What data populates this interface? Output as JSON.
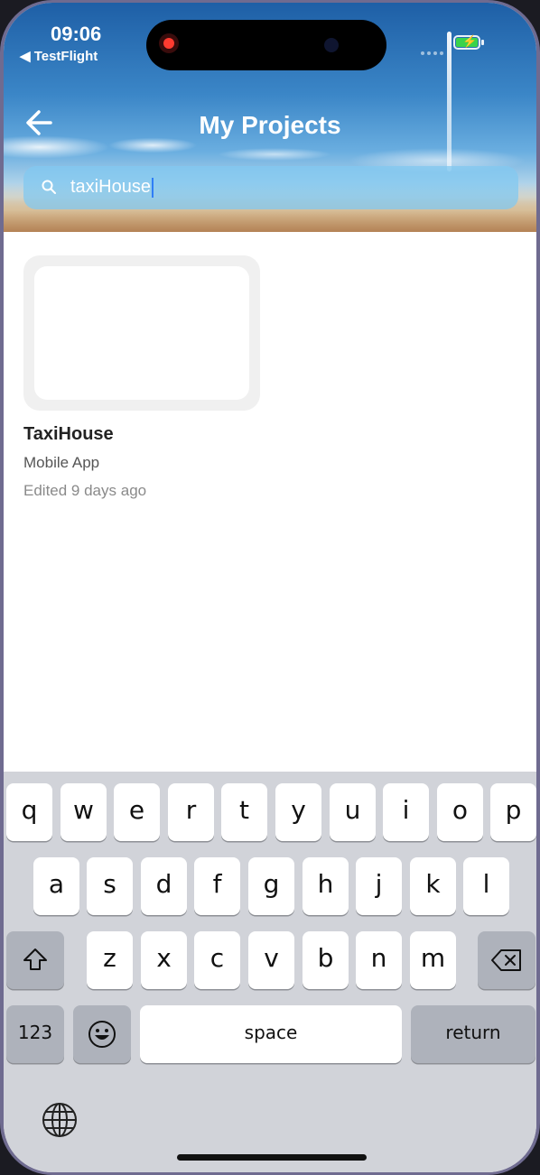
{
  "status_bar": {
    "time": "09:06",
    "back_to_app": "◀ TestFlight",
    "battery_color": "#3ad34b"
  },
  "header": {
    "title": "My Projects",
    "back_icon": "arrow-left-icon"
  },
  "search": {
    "value": "taxiHouse",
    "icon": "search-icon"
  },
  "projects": [
    {
      "name": "TaxiHouse",
      "type": "Mobile App",
      "edited": "Edited 9 days ago"
    }
  ],
  "keyboard": {
    "row1": [
      "q",
      "w",
      "e",
      "r",
      "t",
      "y",
      "u",
      "i",
      "o",
      "p"
    ],
    "row2": [
      "a",
      "s",
      "d",
      "f",
      "g",
      "h",
      "j",
      "k",
      "l"
    ],
    "row3": [
      "z",
      "x",
      "c",
      "v",
      "b",
      "n",
      "m"
    ],
    "numbers_label": "123",
    "space_label": "space",
    "return_label": "return",
    "shift_icon": "shift-icon",
    "delete_icon": "delete-backspace-icon",
    "emoji_icon": "emoji-icon",
    "globe_icon": "globe-icon"
  }
}
